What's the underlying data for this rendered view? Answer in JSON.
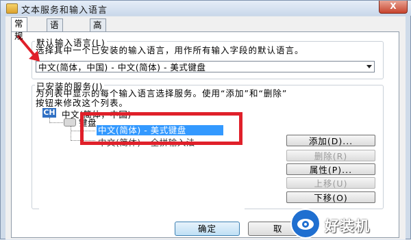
{
  "window": {
    "title": "文本服务和输入语言",
    "close_label": "X"
  },
  "tabs": [
    {
      "label": "常规"
    },
    {
      "label": "语言栏"
    },
    {
      "label": "高级键设置"
    }
  ],
  "default_language": {
    "legend": "默认输入语言(L)",
    "description": "选择其中一个已安装的输入语言，用作所有输入字段的默认语言。",
    "selected": "中文(简体，中国) - 中文(简体) - 美式键盘"
  },
  "installed_services": {
    "legend": "已安装的服务(I)",
    "description_line1": "为列表中显示的每个输入语言选择服务。使用“添加”和“删除”",
    "description_line2": "按钮来修改这个列表。",
    "tree": {
      "language_badge": "CH",
      "language": "中文(简体，中国)",
      "category": "键盘",
      "selected_item": "中文(简体) - 美式键盘",
      "second_item": "中文(简体) - 全拼输入法"
    },
    "buttons": {
      "add": "添加(D)...",
      "remove": "删除(R)",
      "properties": "属性(P)...",
      "move_up": "上移(U)",
      "move_down": "下移(O)"
    }
  },
  "footer": {
    "ok": "确定",
    "cancel": "取"
  },
  "watermark": {
    "text": "好装机"
  },
  "colors": {
    "annotation_red": "#e0202a",
    "selection_blue": "#3399ff"
  }
}
